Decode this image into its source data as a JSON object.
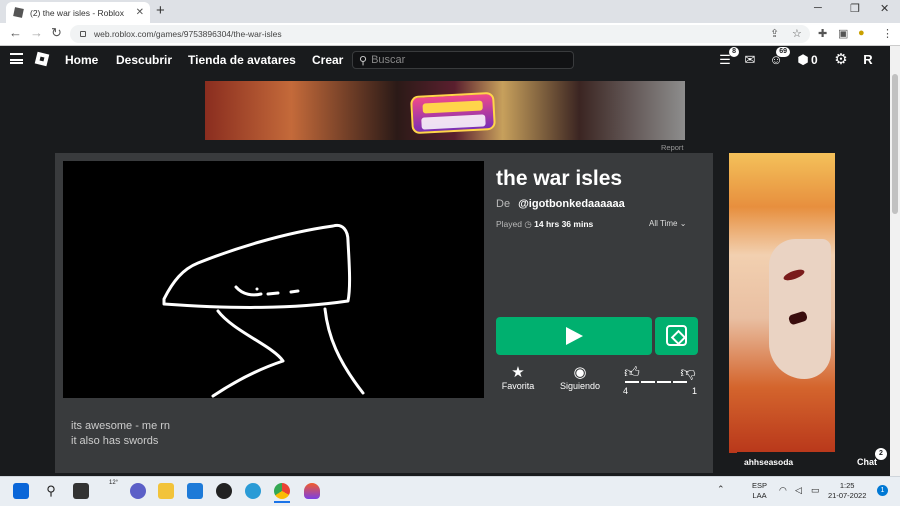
{
  "browser": {
    "tab_title": "(2) the war isles - Roblox",
    "url": "web.roblox.com/games/9753896304/the-war-isles",
    "new_tab": "+"
  },
  "header": {
    "nav": [
      "Home",
      "Descubrir",
      "Tienda de avatares",
      "Crear"
    ],
    "search_placeholder": "Buscar",
    "catalog_badge": "8",
    "friends_badge": "69",
    "robux": "0"
  },
  "ad": {
    "report": "Report"
  },
  "game": {
    "title": "the war isles",
    "by_label": "De",
    "creator": "@igotbonkedaaaaaa",
    "played_label": "Played",
    "played_time": "14 hrs 36 mins",
    "time_filter": "All Time",
    "favorite_label": "Favorita",
    "following_label": "Siguiendo",
    "likes": "4",
    "dislikes": "1",
    "description": [
      "its awesome - me rn",
      "it also has swords"
    ]
  },
  "chat": {
    "user": "ahhseasoda",
    "label": "Chat",
    "badge": "2"
  },
  "taskbar": {
    "lang1": "ESP",
    "lang2": "LAA",
    "time": "1:25",
    "date": "21-07-2022",
    "weather": "12°",
    "notifications": "1"
  },
  "colors": {
    "play_green": "#00b06f",
    "page_bg": "#191b1d",
    "card_bg": "#393b3d"
  }
}
